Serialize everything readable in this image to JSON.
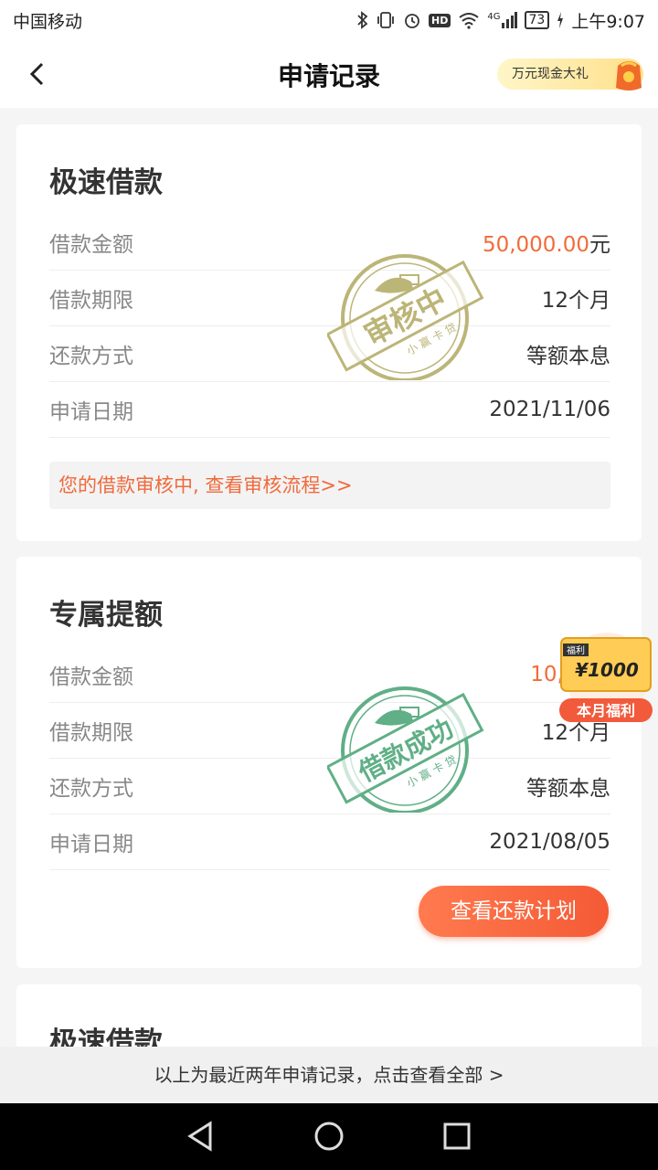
{
  "status": {
    "carrier": "中国移动",
    "battery": "73",
    "network": "4G",
    "hd": "HD",
    "time": "上午9:07"
  },
  "nav": {
    "title": "申请记录",
    "promo_text": "万元现金大礼"
  },
  "cards": [
    {
      "title": "极速借款",
      "rows": [
        {
          "label": "借款金额",
          "amount": "50,000.00",
          "unit": "元"
        },
        {
          "label": "借款期限",
          "value": "12个月"
        },
        {
          "label": "还款方式",
          "value": "等额本息"
        },
        {
          "label": "申请日期",
          "value": "2021/11/06"
        }
      ],
      "stamp": {
        "text": "审核中",
        "brand": "小 赢 卡 贷",
        "color": "#b5ad6a"
      },
      "notice": "您的借款审核中, 查看审核流程>>"
    },
    {
      "title": "专属提额",
      "rows": [
        {
          "label": "借款金额",
          "amount": "10,000.",
          "unit": ""
        },
        {
          "label": "借款期限",
          "value": "12个月"
        },
        {
          "label": "还款方式",
          "value": "等额本息"
        },
        {
          "label": "申请日期",
          "value": "2021/08/05"
        }
      ],
      "stamp": {
        "text": "借款成功",
        "brand": "小 赢 卡 贷",
        "color": "#4fa77a"
      },
      "button": "查看还款计划"
    },
    {
      "title": "极速借款"
    }
  ],
  "welfare": {
    "tag": "福利",
    "amount": "¥1000",
    "label": "本月福利"
  },
  "footer": {
    "text": "以上为最近两年申请记录，点击查看全部 >"
  },
  "colors": {
    "accent": "#f26b3a",
    "pending_stamp": "#b5ad6a",
    "success_stamp": "#4fa77a"
  }
}
